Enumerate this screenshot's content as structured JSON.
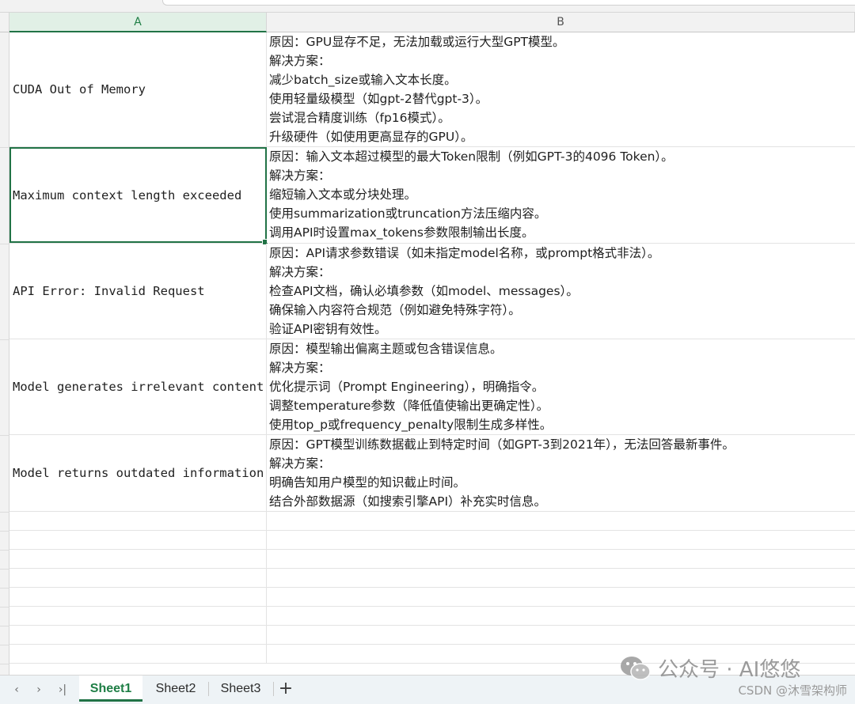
{
  "columns": [
    {
      "label": "A",
      "selected": true
    },
    {
      "label": "B",
      "selected": false
    }
  ],
  "rows": [
    {
      "a": "CUDA Out of Memory",
      "b": [
        "原因：GPU显存不足，无法加载或运行大型GPT模型。",
        "解决方案：",
        "减少batch_size或输入文本长度。",
        "使用轻量级模型（如gpt-2替代gpt-3）。",
        "尝试混合精度训练（fp16模式）。",
        "升级硬件（如使用更高显存的GPU）。"
      ]
    },
    {
      "a": "Maximum context length exceeded",
      "b": [
        "原因：输入文本超过模型的最大Token限制（例如GPT-3的4096 Token）。",
        "解决方案：",
        "缩短输入文本或分块处理。",
        "使用summarization或truncation方法压缩内容。",
        "调用API时设置max_tokens参数限制输出长度。"
      ]
    },
    {
      "a": "API Error: Invalid Request",
      "b": [
        "原因：API请求参数错误（如未指定model名称，或prompt格式非法）。",
        "解决方案：",
        "检查API文档，确认必填参数（如model、messages）。",
        "确保输入内容符合规范（例如避免特殊字符）。",
        "验证API密钥有效性。"
      ]
    },
    {
      "a": "Model generates irrelevant content",
      "b": [
        "原因：模型输出偏离主题或包含错误信息。",
        "解决方案：",
        "优化提示词（Prompt Engineering），明确指令。",
        "调整temperature参数（降低值使输出更确定性）。",
        "使用top_p或frequency_penalty限制生成多样性。"
      ]
    },
    {
      "a": "Model returns outdated information",
      "b": [
        "原因：GPT模型训练数据截止到特定时间（如GPT-3到2021年），无法回答最新事件。",
        "解决方案：",
        "明确告知用户模型的知识截止时间。",
        "结合外部数据源（如搜索引擎API）补充实时信息。"
      ]
    }
  ],
  "active_cell": "A2",
  "sheet_tabs": [
    {
      "label": "Sheet1",
      "active": true
    },
    {
      "label": "Sheet2",
      "active": false
    },
    {
      "label": "Sheet3",
      "active": false
    }
  ],
  "nav_icons": [
    "prev-sheet-icon",
    "next-sheet-icon",
    "last-sheet-icon"
  ],
  "nav_glyphs": {
    "first": "‹",
    "next": "›",
    "last": "›|"
  },
  "add_sheet_label": "+",
  "watermark": {
    "text": "公众号 · AI悠悠",
    "icon": "wechat-icon"
  },
  "csdn_mark": "CSDN @沐雪架构师",
  "colors": {
    "accent": "#217346",
    "accent_text": "#1e7e45",
    "gridline": "#e3e3e3",
    "header_bg": "#f2f2f2"
  }
}
